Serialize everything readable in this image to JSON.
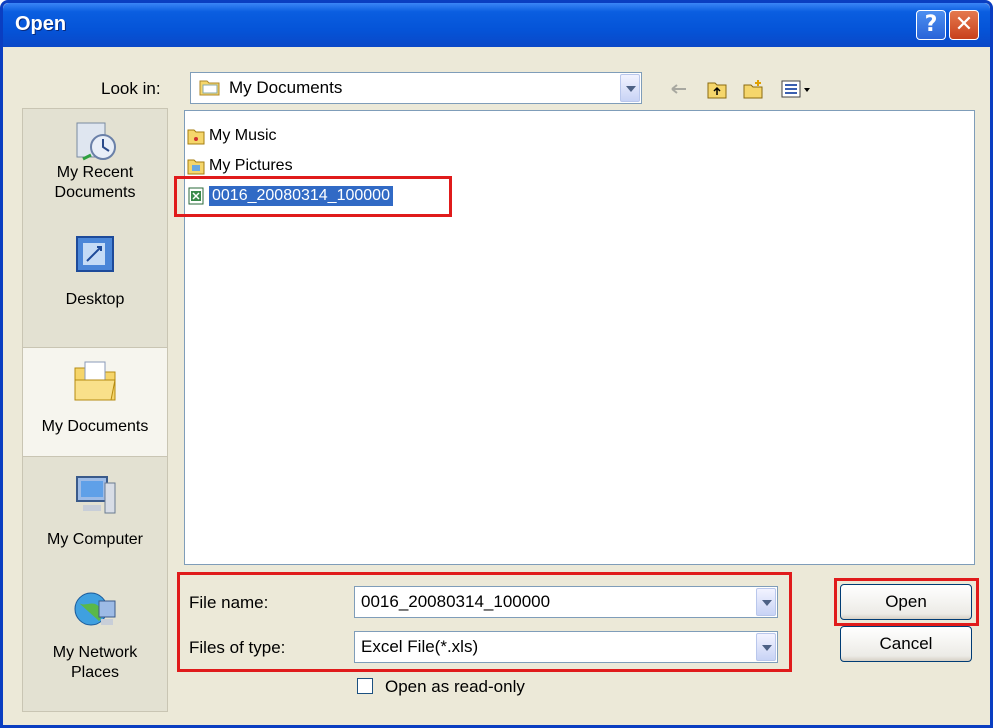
{
  "window": {
    "title": "Open"
  },
  "lookin": {
    "label": "Look in:",
    "value": "My Documents"
  },
  "places": [
    {
      "label": "My Recent Documents",
      "icon": "recent-documents-icon"
    },
    {
      "label": "Desktop",
      "icon": "desktop-icon"
    },
    {
      "label": "My Documents",
      "icon": "my-documents-icon",
      "active": true
    },
    {
      "label": "My Computer",
      "icon": "my-computer-icon"
    },
    {
      "label": "My Network Places",
      "icon": "network-places-icon"
    }
  ],
  "files": [
    {
      "name": "My Music",
      "icon": "folder-music-icon"
    },
    {
      "name": "My Pictures",
      "icon": "folder-pictures-icon"
    },
    {
      "name": "0016_20080314_100000",
      "icon": "excel-file-icon",
      "selected": true
    }
  ],
  "filename": {
    "label": "File name:",
    "value": "0016_20080314_100000"
  },
  "filetype": {
    "label": "Files of type:",
    "value": "Excel File(*.xls)"
  },
  "readonly": {
    "label": "Open as read-only"
  },
  "buttons": {
    "open": "Open",
    "cancel": "Cancel"
  },
  "colors": {
    "titlebar": "#0554d8",
    "highlight": "#e01b1b",
    "selection": "#316ac5"
  }
}
